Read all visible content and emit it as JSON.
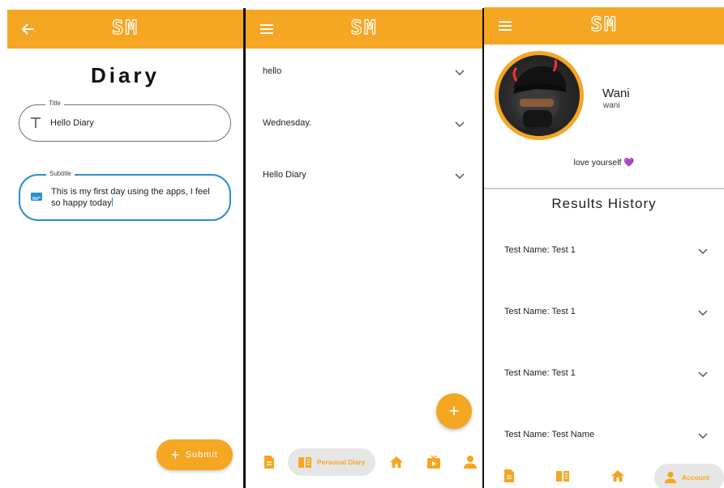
{
  "brand": {
    "logo": "SM",
    "accent": "#f5a623",
    "focus_color": "#2b8fcf"
  },
  "diary_form": {
    "back_icon": "arrow-left-icon",
    "heading": "Diary",
    "title_field": {
      "label": "Title",
      "value": "Hello Diary",
      "icon": "text-t-icon"
    },
    "subtitle_field": {
      "label": "Subtitle",
      "value": "This is my first day using the apps, I feel so happy today",
      "icon": "subtitles-icon"
    },
    "submit_label": "Submit"
  },
  "diary_list": {
    "menu_icon": "hamburger-menu-icon",
    "entries": [
      "hello",
      "Wednesday.",
      "Hello Diary"
    ],
    "fab_icon": "plus-icon",
    "bottom_nav": {
      "active_label": "Personal Diary",
      "items": [
        "notes-icon",
        "diary-book-icon",
        "home-icon",
        "video-icon",
        "account-icon"
      ]
    }
  },
  "profile": {
    "menu_icon": "hamburger-menu-icon",
    "name": "Wani",
    "username": "wani",
    "bio": "love yourself",
    "bio_emoji": "💜",
    "results_title": "Results History",
    "results": [
      "Test Name: Test 1",
      "Test Name: Test 1",
      "Test Name: Test 1",
      "Test Name: Test Name"
    ],
    "bottom_nav": {
      "active_label": "Account",
      "items": [
        "notes-icon",
        "diary-book-icon",
        "home-icon",
        "account-icon"
      ]
    }
  }
}
